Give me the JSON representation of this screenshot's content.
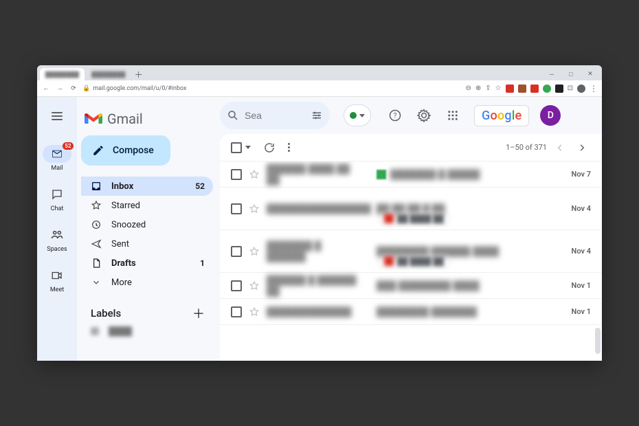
{
  "browser": {
    "url": "mail.google.com/mail/u/0/#inbox",
    "tabs": [
      {
        "label": "████████"
      },
      {
        "label": "████████"
      }
    ]
  },
  "rail": {
    "mail": {
      "label": "Mail",
      "badge": "52"
    },
    "chat": {
      "label": "Chat"
    },
    "spaces": {
      "label": "Spaces"
    },
    "meet": {
      "label": "Meet"
    }
  },
  "brand": {
    "name": "Gmail"
  },
  "compose": {
    "label": "Compose"
  },
  "folders": {
    "inbox": {
      "label": "Inbox",
      "count": "52"
    },
    "starred": {
      "label": "Starred"
    },
    "snoozed": {
      "label": "Snoozed"
    },
    "sent": {
      "label": "Sent"
    },
    "drafts": {
      "label": "Drafts",
      "count": "1"
    },
    "more": {
      "label": "More"
    }
  },
  "labels": {
    "heading": "Labels"
  },
  "search": {
    "placeholder": "Sea"
  },
  "google_logo": "Google",
  "avatar": {
    "initial": "D"
  },
  "toolbar": {
    "range_text": "1–50 of 371"
  },
  "messages": [
    {
      "sender": "██████ ████ ██ ██",
      "subject": "███████ █ █████",
      "date": "Nov 7",
      "favicon": "green",
      "attach": false
    },
    {
      "sender": "████████████████",
      "subject": "██ ██ ██ █ ██",
      "date": "Nov 4",
      "favicon": "",
      "attach": true,
      "attach_color": "red"
    },
    {
      "sender": "███████ █ ██████",
      "subject": "████████ ██████ ████",
      "date": "Nov 4",
      "favicon": "",
      "attach": true,
      "attach_color": "red"
    },
    {
      "sender": "██████ █ ██████ ██",
      "subject": "███ ████████ ████",
      "date": "Nov 1",
      "favicon": "",
      "attach": false
    },
    {
      "sender": "█████████████",
      "subject": "████████ ███████",
      "date": "Nov 1",
      "favicon": "",
      "attach": false
    }
  ]
}
